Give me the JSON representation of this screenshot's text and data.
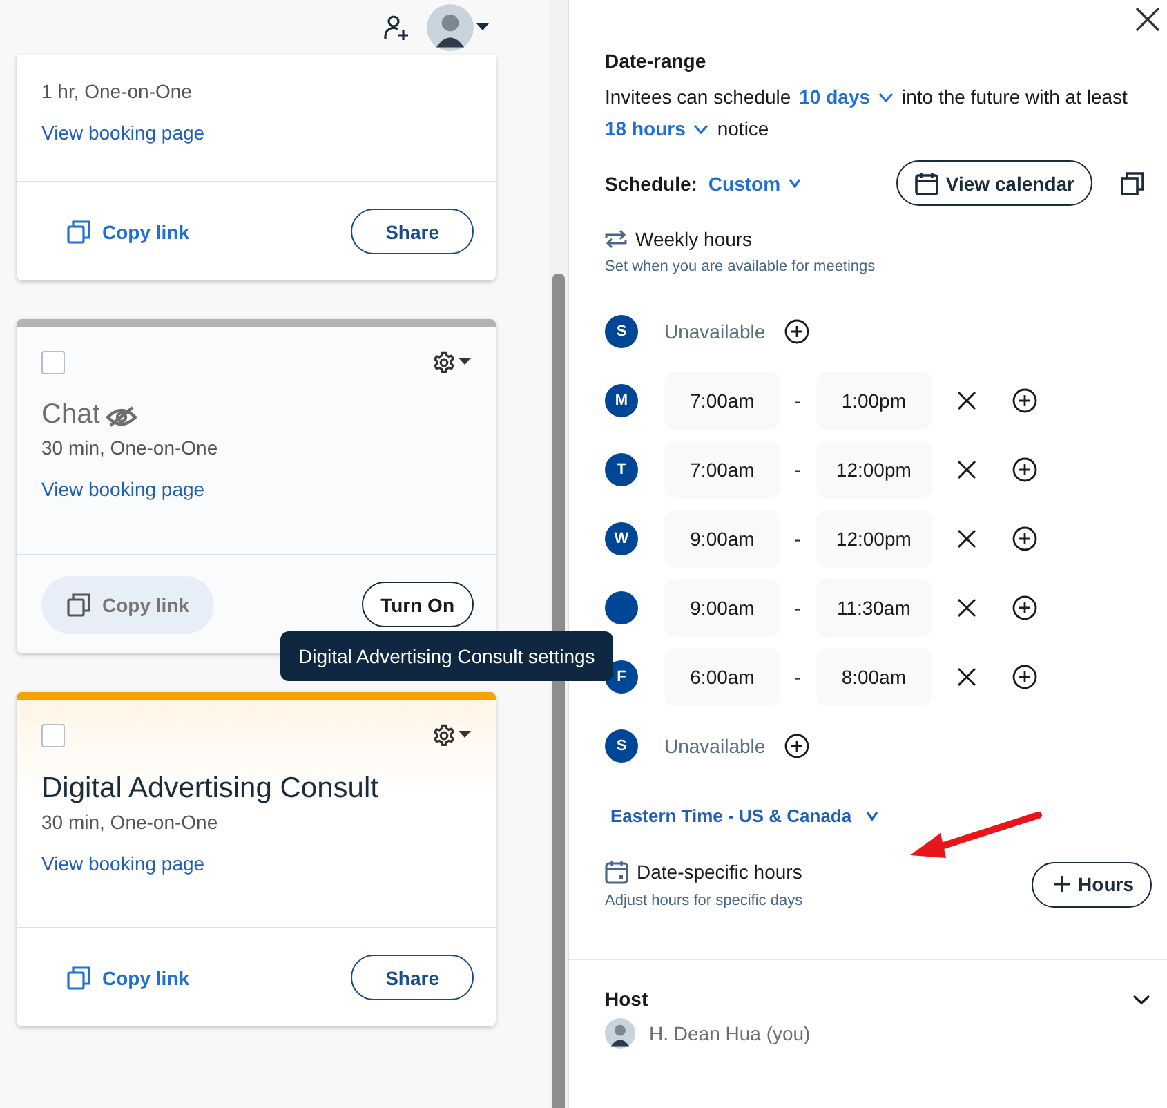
{
  "cards": [
    {
      "subtitle": "1 hr, One-on-One",
      "link": "View booking page",
      "copy_link": {
        "label": "Copy link",
        "disabled": false
      },
      "action": "Share"
    },
    {
      "color": "#b3b3b3",
      "checked": false,
      "title": "Chat",
      "hidden": true,
      "subtitle": "30 min, One-on-One",
      "link": "View booking page",
      "copy_link": {
        "label": "Copy link",
        "disabled": true
      },
      "action": "Turn On"
    },
    {
      "color": "#f5a300",
      "checked": false,
      "title": "Digital Advertising Consult",
      "hidden": false,
      "subtitle": "30 min, One-on-One",
      "link": "View booking page",
      "copy_link": {
        "label": "Copy link",
        "disabled": false
      },
      "action": "Share"
    }
  ],
  "tooltip": "Digital Advertising Consult settings",
  "panel": {
    "date_range": {
      "heading": "Date-range",
      "sentence": [
        {
          "kind": "text",
          "text": "Invitees can schedule"
        },
        {
          "kind": "dropdown",
          "text": "10 days"
        },
        {
          "kind": "text",
          "text": "into the future with at least"
        },
        {
          "kind": "dropdown",
          "text": "18 hours"
        },
        {
          "kind": "text",
          "text": "notice"
        }
      ]
    },
    "schedule": {
      "label": "Schedule:",
      "value": "Custom",
      "button": "View calendar"
    },
    "weekly": {
      "title": "Weekly hours",
      "hint": "Set when you are available for meetings"
    },
    "days": [
      {
        "day": "S",
        "kind": "unavailable",
        "text": "Unavailable"
      },
      {
        "day": "M",
        "kind": "hours",
        "start": "7:00am",
        "separator": "-",
        "end": "1:00pm"
      },
      {
        "day": "T",
        "kind": "hours",
        "start": "7:00am",
        "separator": "-",
        "end": "12:00pm"
      },
      {
        "day": "W",
        "kind": "hours",
        "start": "9:00am",
        "separator": "-",
        "end": "12:00pm"
      },
      {
        "kind": "hours",
        "start": "9:00am",
        "separator": "-",
        "end": "11:30am"
      },
      {
        "day": "F",
        "kind": "hours",
        "start": "6:00am",
        "separator": "-",
        "end": "8:00am"
      },
      {
        "day": "S",
        "kind": "unavailable",
        "text": "Unavailable"
      }
    ],
    "timezone": "Eastern Time - US & Canada",
    "date_specific": {
      "title": "Date-specific hours",
      "hint": "Adjust hours for specific days",
      "button": "Hours"
    },
    "host": {
      "heading": "Host",
      "name": "H. Dean Hua (you)"
    }
  }
}
